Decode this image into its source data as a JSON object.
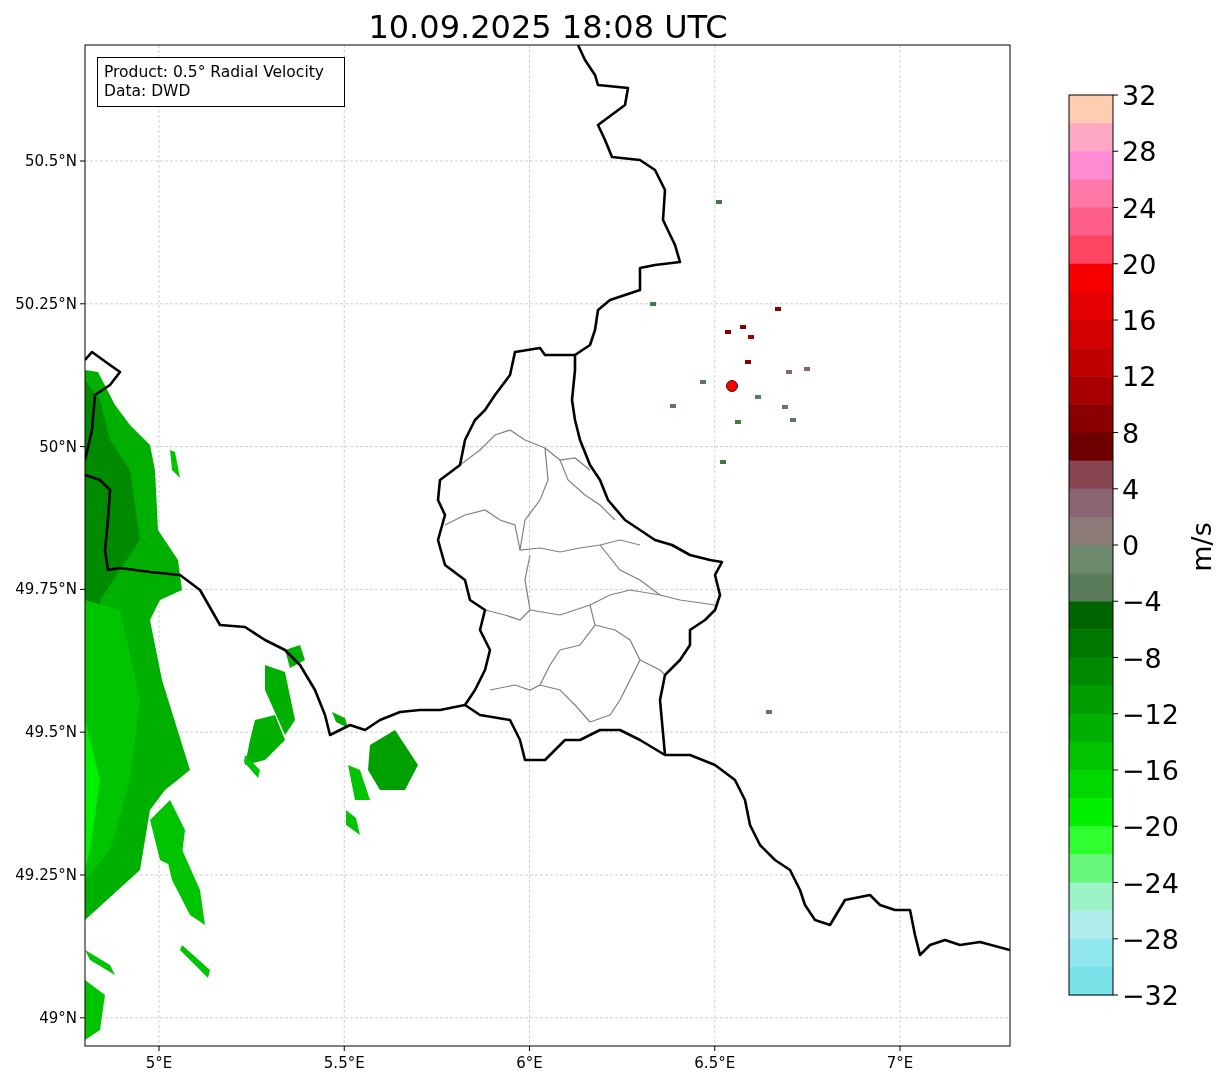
{
  "title": "10.09.2025 18:08 UTC",
  "map": {
    "info_box": [
      "Product: 0.5° Radial Velocity",
      "Data: DWD"
    ],
    "x_ticks": [
      "5°E",
      "5.5°E",
      "6°E",
      "6.5°E",
      "7°E"
    ],
    "y_ticks": [
      "50.5°N",
      "50.25°N",
      "50°N",
      "49.75°N",
      "49.5°N",
      "49.25°N",
      "49°N"
    ]
  },
  "colorbar": {
    "label": "m/s",
    "ticks": [
      "32",
      "28",
      "24",
      "20",
      "16",
      "12",
      "8",
      "4",
      "0",
      "−4",
      "−8",
      "−12",
      "−16",
      "−20",
      "−24",
      "−28",
      "−32"
    ],
    "segments": [
      {
        "color": "#ffcdb0"
      },
      {
        "color": "#ffa8c4"
      },
      {
        "color": "#ff8bd2"
      },
      {
        "color": "#ff78a8"
      },
      {
        "color": "#ff5f88"
      },
      {
        "color": "#ff4462"
      },
      {
        "color": "#f80000"
      },
      {
        "color": "#e40000"
      },
      {
        "color": "#d20000"
      },
      {
        "color": "#c00000"
      },
      {
        "color": "#a80000"
      },
      {
        "color": "#8a0000"
      },
      {
        "color": "#6e0000"
      },
      {
        "color": "#884650"
      },
      {
        "color": "#8a6470"
      },
      {
        "color": "#8c7a78"
      },
      {
        "color": "#6e8a6c"
      },
      {
        "color": "#5a7c5a"
      },
      {
        "color": "#006400"
      },
      {
        "color": "#007800"
      },
      {
        "color": "#008a00"
      },
      {
        "color": "#009e00"
      },
      {
        "color": "#00b000"
      },
      {
        "color": "#00c400"
      },
      {
        "color": "#00d800"
      },
      {
        "color": "#00f000"
      },
      {
        "color": "#30ff30"
      },
      {
        "color": "#66f77a"
      },
      {
        "color": "#9ef2c8"
      },
      {
        "color": "#b0eeee"
      },
      {
        "color": "#90e8ee"
      },
      {
        "color": "#78e2e8"
      }
    ]
  }
}
